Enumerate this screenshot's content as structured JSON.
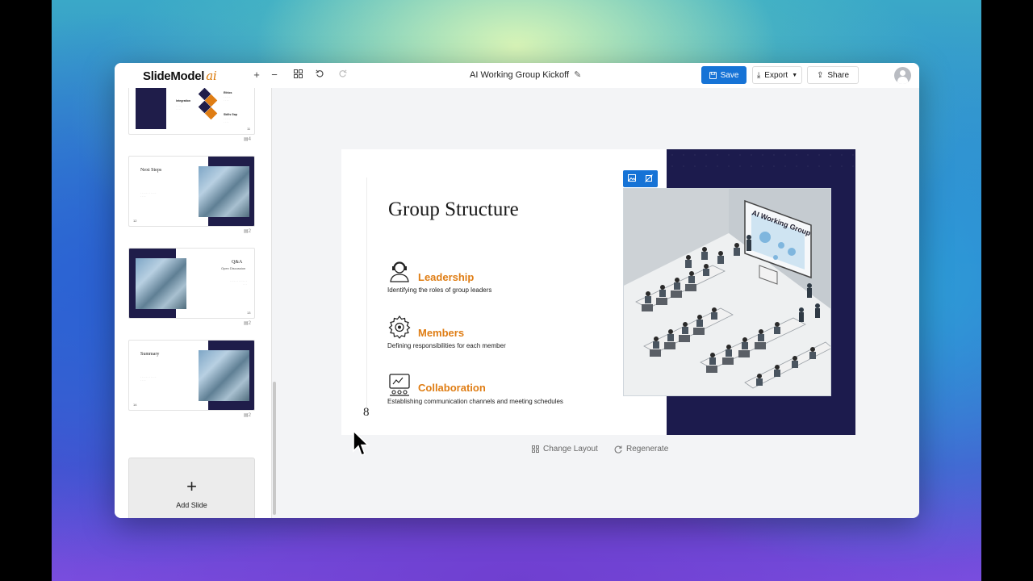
{
  "app": {
    "logo_text": "SlideModel",
    "logo_suffix": "ai",
    "doc_title": "AI Working Group Kickoff"
  },
  "toolbar": {
    "save_label": "Save",
    "export_label": "Export",
    "share_label": "Share"
  },
  "sidebar": {
    "slides": [
      {
        "number": "11",
        "layout_count": "4",
        "title": "",
        "items": [
          "Integration",
          "Ethics",
          "Skills Gap"
        ]
      },
      {
        "number": "12",
        "layout_count": "2",
        "title": "Next Steps",
        "subtitle": ""
      },
      {
        "number": "13",
        "layout_count": "2",
        "title": "Q&A",
        "subtitle": "Open Discussion"
      },
      {
        "number": "14",
        "layout_count": "2",
        "title": "Summary",
        "subtitle": ""
      }
    ],
    "add_slide_label": "Add Slide"
  },
  "slide": {
    "title": "Group Structure",
    "page_number": "8",
    "items": [
      {
        "heading": "Leadership",
        "description": "Identifying the roles of group leaders",
        "icon": "headset-person-icon"
      },
      {
        "heading": "Members",
        "description": "Defining responsibilities for each member",
        "icon": "gear-icon"
      },
      {
        "heading": "Collaboration",
        "description": "Establishing communication channels and meeting schedules",
        "icon": "collaboration-screen-icon"
      }
    ],
    "photo_caption": "AI Working Group",
    "colors": {
      "navy": "#1c1b4d",
      "accent": "#df7d14",
      "primary": "#1673d6"
    }
  },
  "actions": {
    "change_layout_label": "Change Layout",
    "regenerate_label": "Regenerate"
  }
}
